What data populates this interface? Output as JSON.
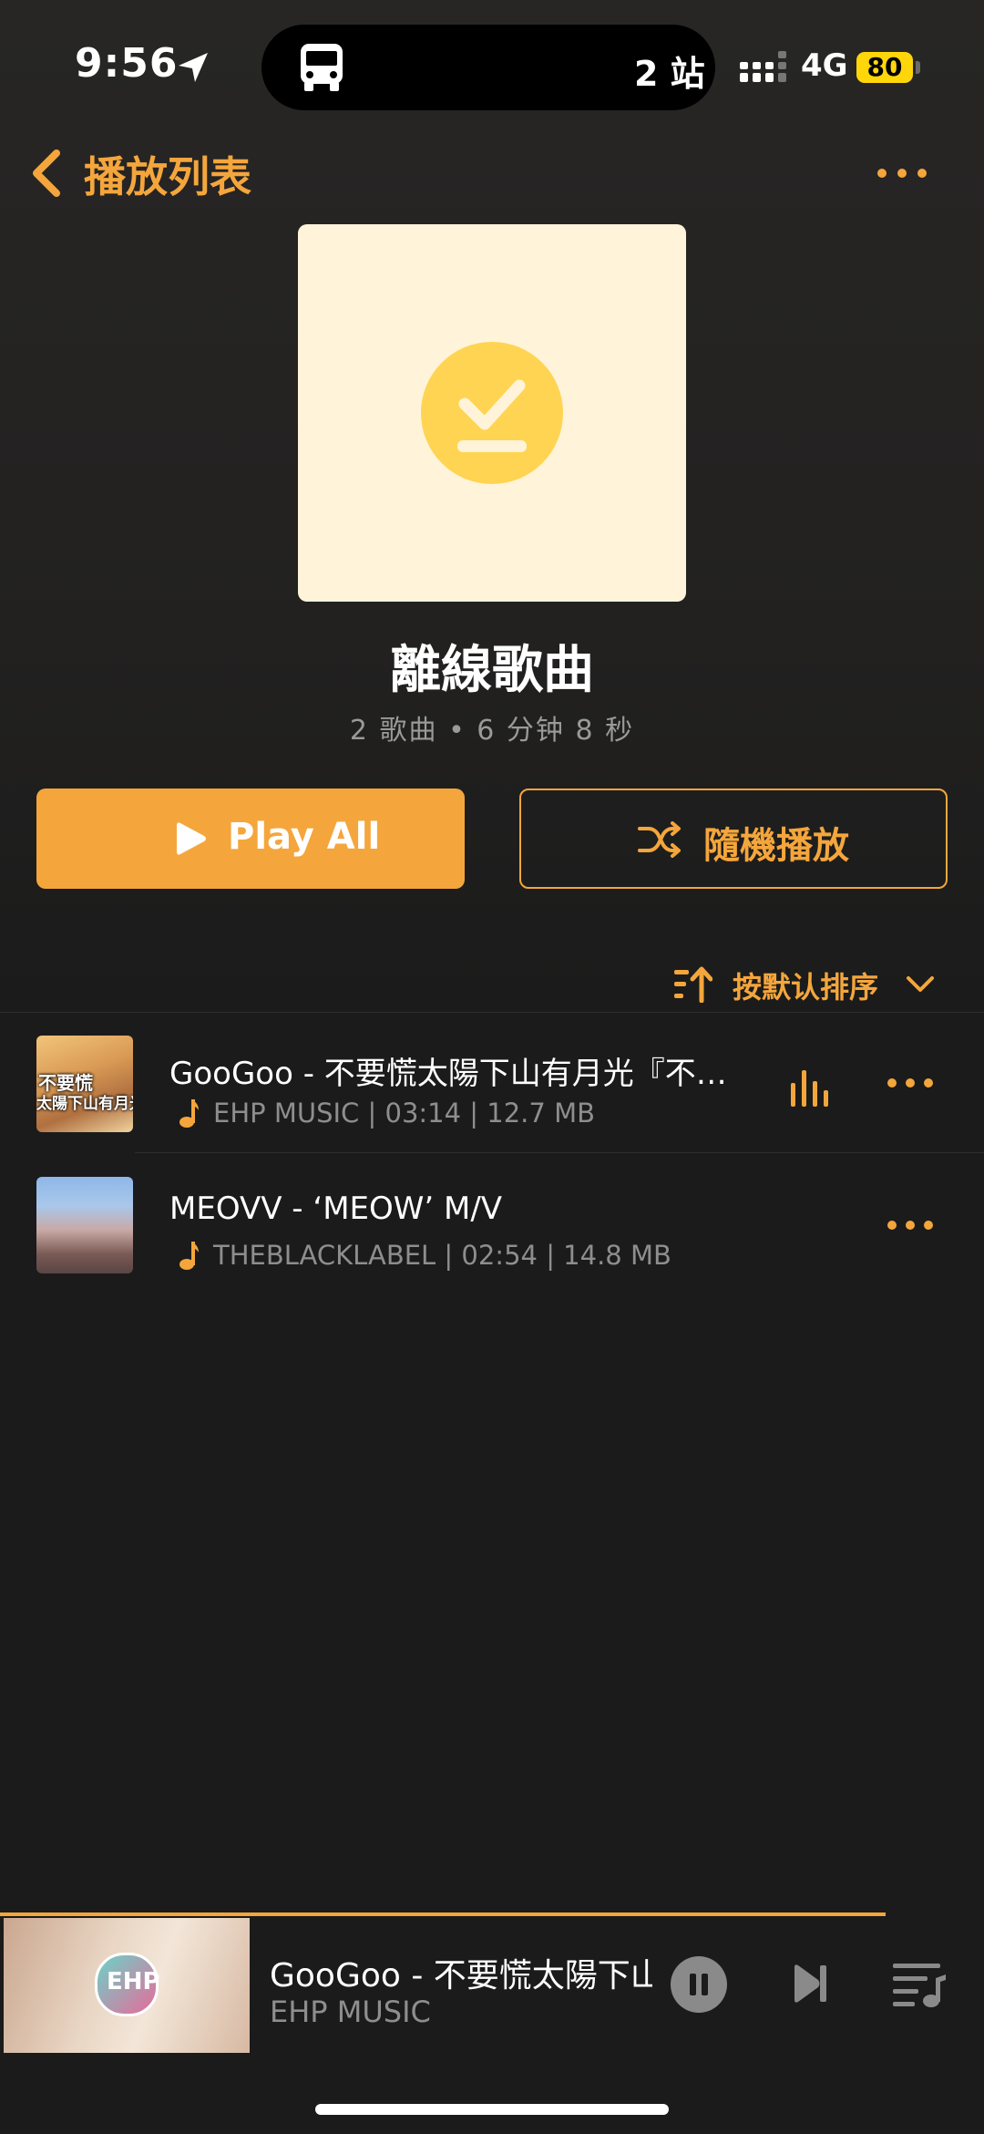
{
  "status_bar": {
    "time": "9:56",
    "island_text": "2 站",
    "network": "4G",
    "battery": "80"
  },
  "nav": {
    "title": "播放列表"
  },
  "album": {
    "title": "離線歌曲",
    "meta": "2 歌曲 • 6 分钟 8 秒"
  },
  "actions": {
    "play_all": "Play All",
    "shuffle": "隨機播放"
  },
  "sort": {
    "label": "按默认排序"
  },
  "songs": [
    {
      "title": "GooGoo - 不要慌太陽下山有月光『不…",
      "subtitle": "EHP MUSIC | 03:14 | 12.7 MB",
      "thumb_line1": "不要慌",
      "thumb_line2": "太陽下山有月光",
      "playing": true
    },
    {
      "title": "MEOVV - ‘MEOW’ M/V",
      "subtitle": "THEBLACKLABEL | 02:54 | 14.8 MB",
      "playing": false
    }
  ],
  "mini_player": {
    "title": "GooGoo - 不要慌太陽下山有月光",
    "artist": "EHP MUSIC",
    "logo": "EHP",
    "progress": 0.9
  },
  "colors": {
    "accent": "#f4a63c",
    "cover_bg": "#fff4d9",
    "cover_icon": "#ffd452"
  }
}
